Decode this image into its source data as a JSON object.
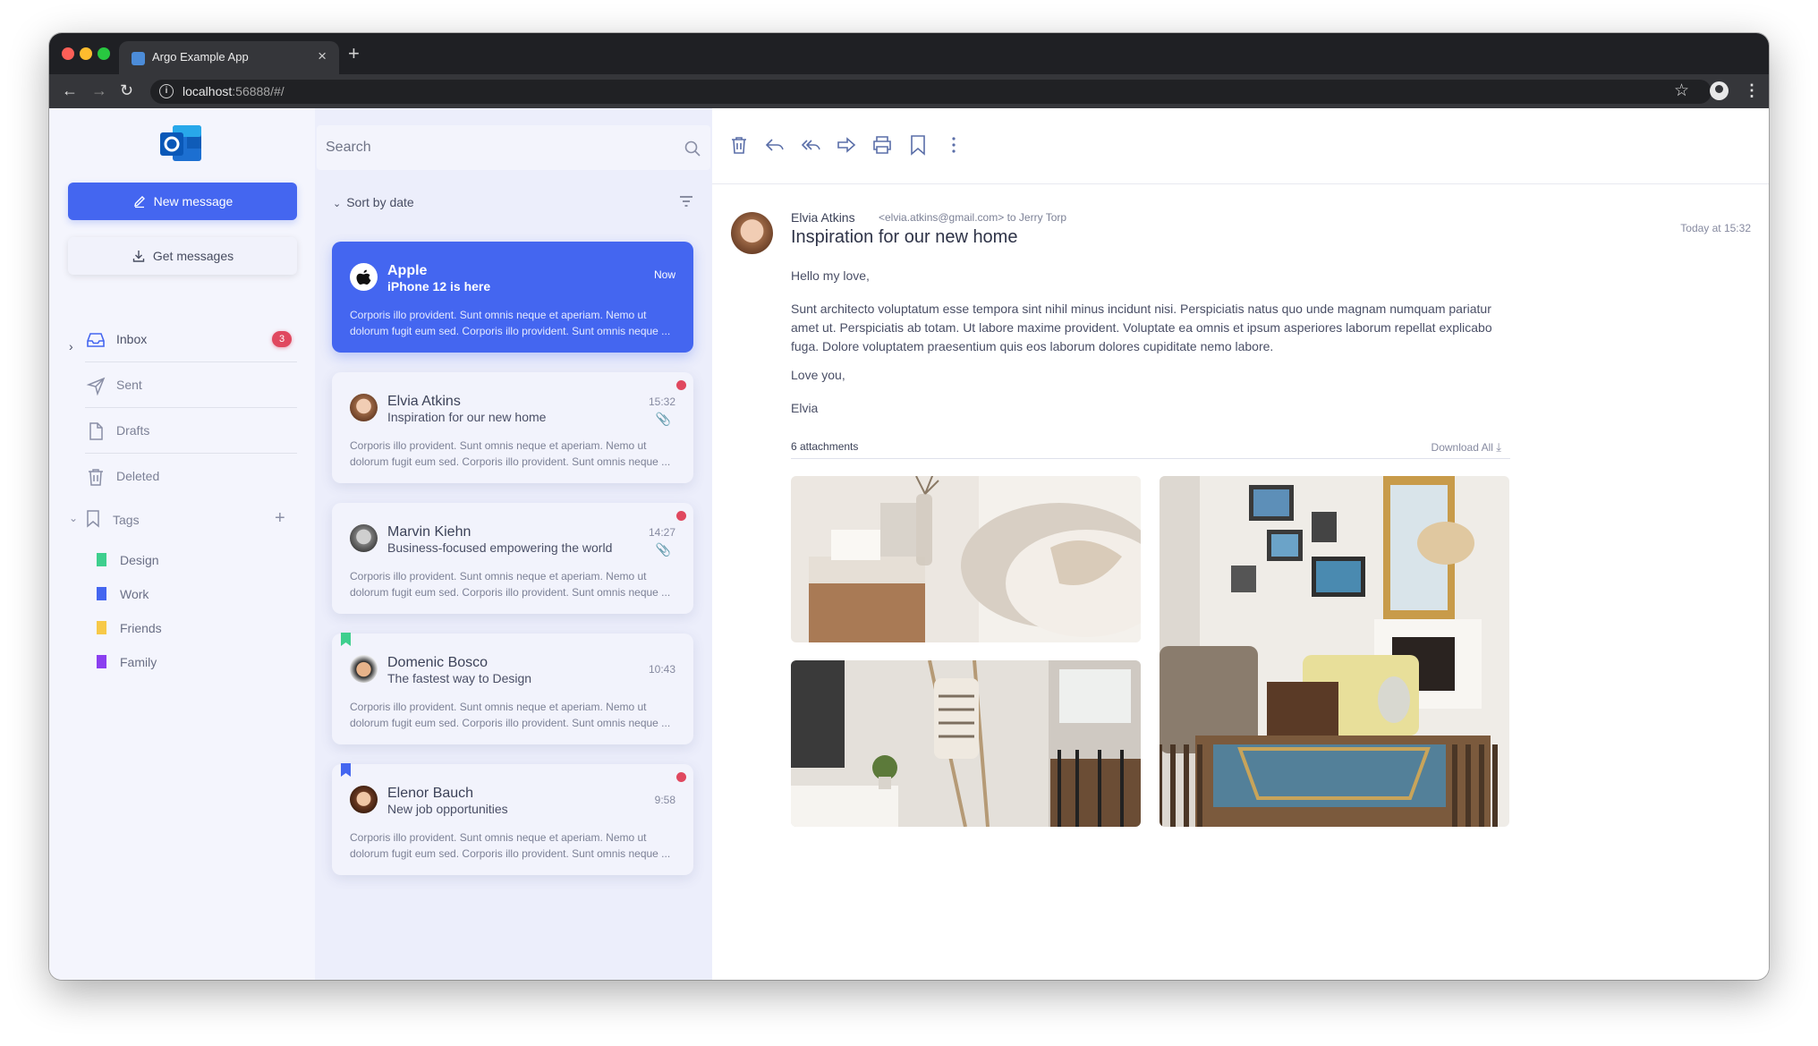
{
  "browser": {
    "tab_title": "Argo Example App",
    "close_icon": "×",
    "new_tab_icon": "+",
    "url_host": "localhost",
    "url_rest": ":56888/#/"
  },
  "sidebar": {
    "new_message": "New message",
    "get_messages": "Get messages",
    "folders": [
      {
        "label": "Inbox",
        "badge": "3",
        "icon": "inbox-icon"
      },
      {
        "label": "Sent",
        "icon": "send-icon"
      },
      {
        "label": "Drafts",
        "icon": "file-icon"
      },
      {
        "label": "Deleted",
        "icon": "trash-icon"
      }
    ],
    "tags_label": "Tags",
    "tags": [
      {
        "label": "Design",
        "color": "#3ecf8e"
      },
      {
        "label": "Work",
        "color": "#4466f0"
      },
      {
        "label": "Friends",
        "color": "#f7c948"
      },
      {
        "label": "Family",
        "color": "#8b3ff0"
      }
    ]
  },
  "list": {
    "search_placeholder": "Search",
    "sort_label": "Sort by date",
    "messages": [
      {
        "name": "Apple",
        "subject": "iPhone 12 is here",
        "time": "Now",
        "preview": "Corporis illo provident. Sunt omnis neque et aperiam. Nemo ut dolorum fugit eum sed. Corporis illo provident. Sunt omnis neque ...",
        "selected": true
      },
      {
        "name": "Elvia Atkins",
        "subject": "Inspiration for our new home",
        "time": "15:32",
        "preview": "Corporis illo provident. Sunt omnis neque et aperiam. Nemo ut dolorum fugit eum sed. Corporis illo provident. Sunt omnis neque ...",
        "unread": true,
        "attachment": true
      },
      {
        "name": "Marvin Kiehn",
        "subject": "Business-focused empowering the world",
        "time": "14:27",
        "preview": "Corporis illo provident. Sunt omnis neque et aperiam. Nemo ut dolorum fugit eum sed. Corporis illo provident. Sunt omnis neque ...",
        "unread": true,
        "attachment": true
      },
      {
        "name": "Domenic Bosco",
        "subject": "The fastest way to Design",
        "time": "10:43",
        "preview": "Corporis illo provident. Sunt omnis neque et aperiam. Nemo ut dolorum fugit eum sed. Corporis illo provident. Sunt omnis neque ...",
        "tag_color": "#3ecf8e"
      },
      {
        "name": "Elenor Bauch",
        "subject": "New job opportunities",
        "time": "9:58",
        "preview": "Corporis illo provident. Sunt omnis neque et aperiam. Nemo ut dolorum fugit eum sed. Corporis illo provident. Sunt omnis neque ...",
        "unread": true,
        "tag_color": "#4466f0"
      }
    ]
  },
  "reader": {
    "toolbar_icons": [
      "trash-icon",
      "reply-icon",
      "reply-all-icon",
      "forward-icon",
      "print-icon",
      "bookmark-icon",
      "more-vertical-icon"
    ],
    "from_name": "Elvia Atkins",
    "from_email": "<elvia.atkins@gmail.com>",
    "to_text": "to Jerry Torp",
    "subject": "Inspiration for our new home",
    "date": "Today at 15:32",
    "greeting": "Hello my love,",
    "body": "Sunt architecto voluptatum esse tempora sint nihil minus incidunt nisi. Perspiciatis natus quo unde magnam numquam pariatur amet ut. Perspiciatis ab totam. Ut labore maxime provident. Voluptate ea omnis et ipsum asperiores laborum repellat explicabo fuga. Dolore voluptatem praesentium quis eos laborum dolores cupiditate nemo labore.",
    "closing": "Love you,",
    "signature": "Elvia",
    "attachments_count": "6 attachments",
    "download_all": "Download All"
  }
}
